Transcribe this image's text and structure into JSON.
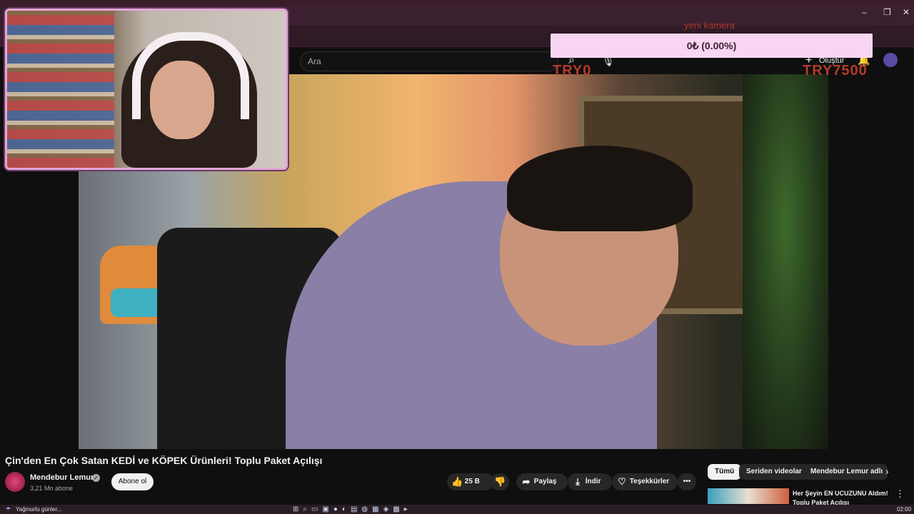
{
  "browser": {
    "window_controls": [
      "–",
      "❐",
      "✕"
    ]
  },
  "youtube": {
    "search_placeholder": "Ara",
    "create_label": "Oluştur",
    "create_icon": "plus-icon",
    "notifications_icon": "bell-icon",
    "voice_icon": "mic-icon"
  },
  "overlay": {
    "donation_text": "0₺ (0.00%)",
    "goal_label": "yeni kamera",
    "goal_min": "TRY0",
    "goal_max": "TRY7500"
  },
  "video": {
    "title": "Çin'den En Çok Satan KEDİ ve KÖPEK Ürünleri! Toplu Paket Açılışı",
    "channel": "Mendebur Lemur",
    "subscribers": "3,21 Mn abone",
    "subscribe_label": "Abone ol",
    "like_count": "25 B",
    "share_label": "Paylaş",
    "download_label": "İndir",
    "thanks_label": "Teşekkürler",
    "more_label": "•••"
  },
  "sidebar": {
    "chips": [
      "Tümü",
      "Seriden videolar",
      "Mendebur Lemur adlı"
    ],
    "active_chip": "Tümü",
    "recommended_title": "Her Şeyin EN UCUZUNU Aldım! Toplu Paket Açılışı"
  },
  "taskbar": {
    "weather_text": "Yağmurlu günler...",
    "clock": "02:00"
  },
  "colors": {
    "accent_pink": "#f8d6f3",
    "goal_red": "#b53a28",
    "yt_bg": "#0f0f0f"
  }
}
